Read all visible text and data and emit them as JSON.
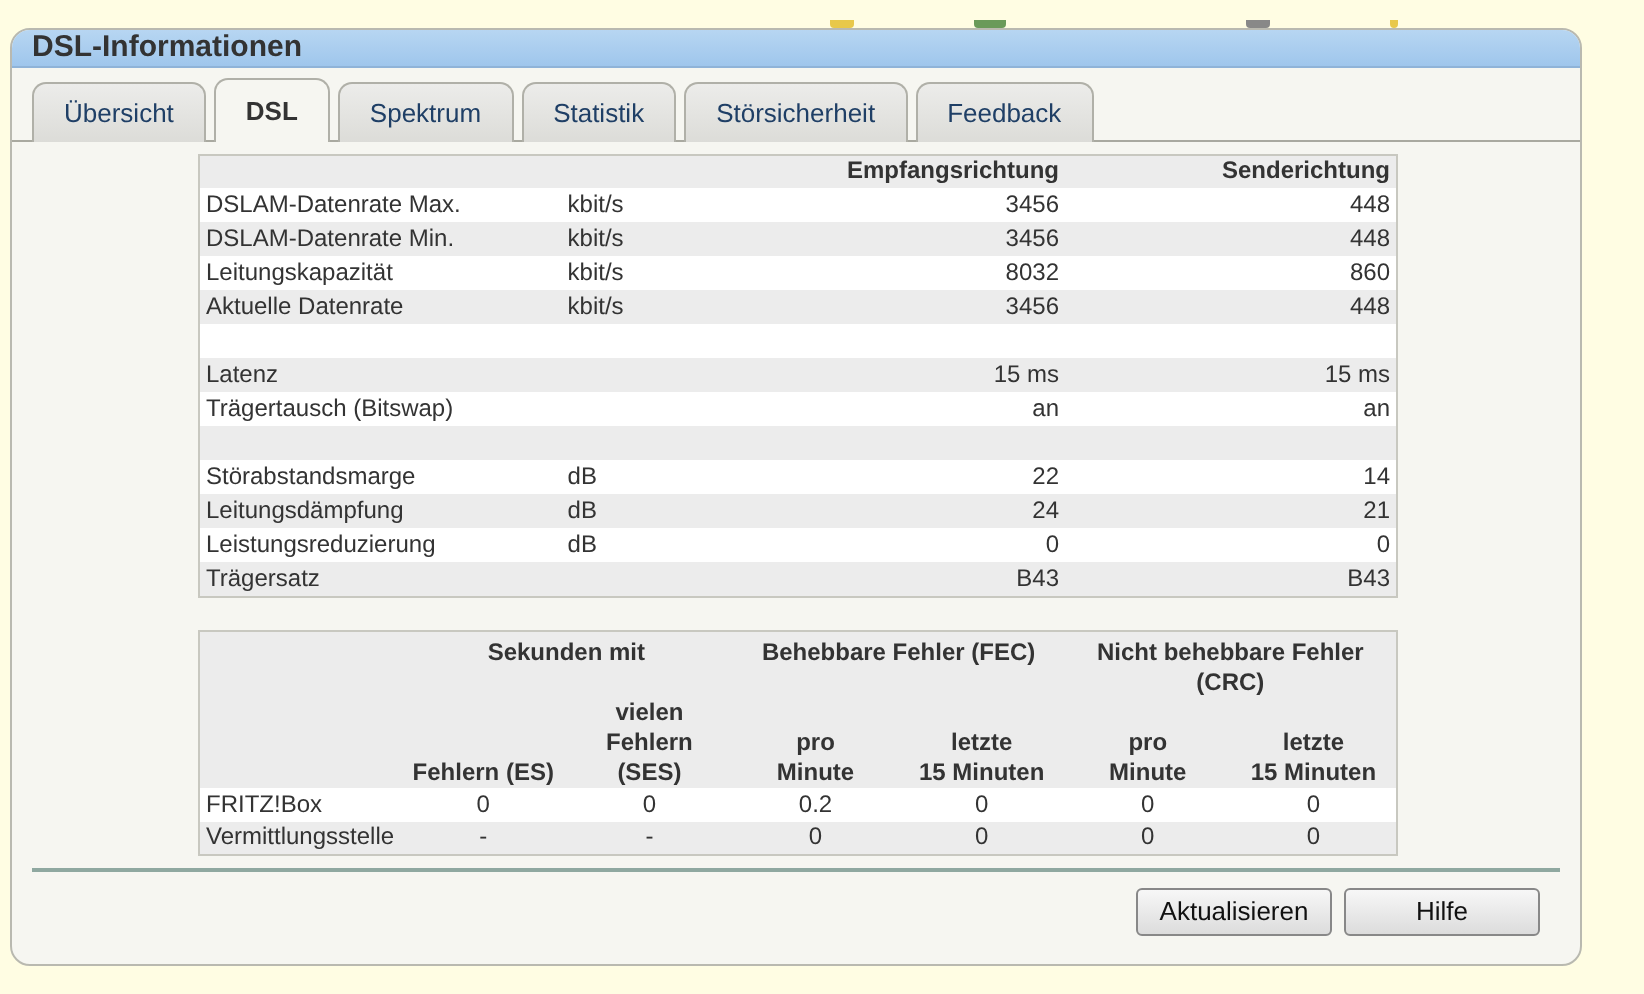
{
  "panel": {
    "title": "DSL-Informationen"
  },
  "tabs": [
    {
      "label": "Übersicht",
      "selected": false
    },
    {
      "label": "DSL",
      "selected": true
    },
    {
      "label": "Spektrum",
      "selected": false
    },
    {
      "label": "Statistik",
      "selected": false
    },
    {
      "label": "Störsicherheit",
      "selected": false
    },
    {
      "label": "Feedback",
      "selected": false
    }
  ],
  "rates_table": {
    "columns": [
      "Empfangsrichtung",
      "Senderichtung"
    ],
    "rows": [
      {
        "kind": "data",
        "label": "DSLAM-Datenrate Max.",
        "unit": "kbit/s",
        "values": [
          "3456",
          "448"
        ]
      },
      {
        "kind": "data",
        "label": "DSLAM-Datenrate Min.",
        "unit": "kbit/s",
        "values": [
          "3456",
          "448"
        ]
      },
      {
        "kind": "data",
        "label": "Leitungskapazität",
        "unit": "kbit/s",
        "values": [
          "8032",
          "860"
        ]
      },
      {
        "kind": "data",
        "label": "Aktuelle Datenrate",
        "unit": "kbit/s",
        "values": [
          "3456",
          "448"
        ]
      },
      {
        "kind": "blank"
      },
      {
        "kind": "data",
        "label": "Latenz",
        "values": [
          "15 ms",
          "15 ms"
        ]
      },
      {
        "kind": "data",
        "label": "Trägertausch (Bitswap)",
        "values": [
          "an",
          "an"
        ]
      },
      {
        "kind": "blank"
      },
      {
        "kind": "data",
        "label": "Störabstandsmarge",
        "unit": "dB",
        "values": [
          "22",
          "14"
        ]
      },
      {
        "kind": "data",
        "label": "Leitungsdämpfung",
        "unit": "dB",
        "values": [
          "24",
          "21"
        ]
      },
      {
        "kind": "data",
        "label": "Leistungsreduzierung",
        "unit": "dB",
        "values": [
          "0",
          "0"
        ]
      },
      {
        "kind": "data",
        "label": "Trägersatz",
        "values": [
          "B43",
          "B43"
        ]
      }
    ]
  },
  "errors_table": {
    "groups": [
      "Sekunden mit",
      "Behebbare Fehler (FEC)",
      "Nicht behebbare Fehler\n(CRC)"
    ],
    "columns": [
      "Fehlern (ES)",
      "vielen\nFehlern (SES)",
      "pro\nMinute",
      "letzte\n15 Minuten",
      "pro\nMinute",
      "letzte\n15 Minuten"
    ],
    "rows": [
      {
        "label": "FRITZ!Box",
        "values": [
          "0",
          "0",
          "0.2",
          "0",
          "0",
          "0"
        ]
      },
      {
        "label": "Vermittlungsstelle",
        "values": [
          "-",
          "-",
          "0",
          "0",
          "0",
          "0"
        ]
      }
    ]
  },
  "buttons": [
    "Aktualisieren",
    "Hilfe"
  ]
}
